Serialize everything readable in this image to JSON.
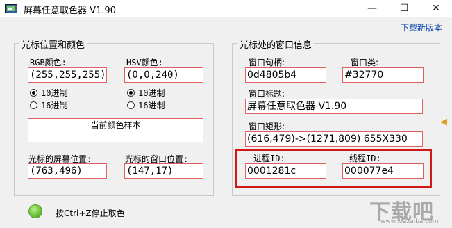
{
  "window": {
    "title": "屏幕任意取色器 V1.90",
    "minimize_glyph": "—",
    "maximize_glyph": "☐",
    "close_glyph": "✕"
  },
  "download_link": "下载新版本",
  "left_group": {
    "title": "光标位置和颜色",
    "rgb_label": "RGB颜色:",
    "rgb_value": "(255,255,255)",
    "hsv_label": "HSV颜色:",
    "hsv_value": "(0,0,240)",
    "rgb_radio_10": "10进制",
    "rgb_radio_16": "16进制",
    "hsv_radio_10": "10进制",
    "hsv_radio_16": "16进制",
    "sample_label": "当前颜色样本",
    "screen_pos_label": "光标的屏幕位置:",
    "screen_pos_value": "(763,496)",
    "window_pos_label": "光标的窗口位置:",
    "window_pos_value": "(147,17)"
  },
  "right_group": {
    "title": "光标处的窗口信息",
    "handle_label": "窗口句柄:",
    "handle_value": "0d4805b4",
    "class_label": "窗口类:",
    "class_value": "#32770",
    "caption_label": "窗口标题:",
    "caption_value": "屏幕任意取色器 V1.90",
    "rect_label": "窗口矩形:",
    "rect_value": "(616,479)->(1271,809) 655X330",
    "process_label": "进程ID:",
    "process_value": "0001281c",
    "thread_label": "线程ID:",
    "thread_value": "000077e4"
  },
  "footer": {
    "hint": "按Ctrl+Z停止取色"
  },
  "side_arrow": "◀",
  "watermark": {
    "text": "下载吧",
    "url": "www.xiazaiba.com"
  },
  "colors": {
    "field_border": "#e06060",
    "highlight": "#d01818",
    "status_led": "#6cc33a"
  }
}
